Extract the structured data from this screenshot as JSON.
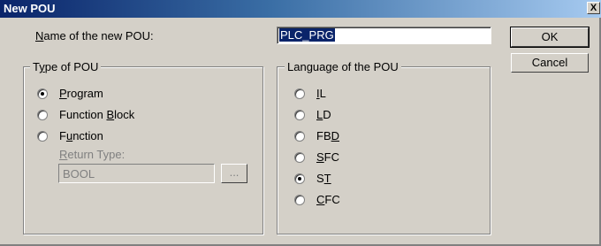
{
  "window": {
    "title": "New POU",
    "close_label": "X"
  },
  "name_label": {
    "pre": "",
    "accel": "N",
    "post": "ame of the new POU:"
  },
  "name_value": "PLC_PRG",
  "buttons": {
    "ok": "OK",
    "cancel": "Cancel"
  },
  "type_group": {
    "legend": {
      "pre": "T",
      "accel": "y",
      "post": "pe of POU"
    },
    "options": [
      {
        "pre": "",
        "accel": "P",
        "post": "rogram",
        "checked": true
      },
      {
        "pre": "Function ",
        "accel": "B",
        "post": "lock",
        "checked": false
      },
      {
        "pre": "F",
        "accel": "u",
        "post": "nction",
        "checked": false
      }
    ],
    "return_type_label": {
      "pre": "",
      "accel": "R",
      "post": "eturn Type:"
    },
    "return_type_value": "BOOL",
    "browse_label": "..."
  },
  "language_group": {
    "legend": "Language of the POU",
    "options": [
      {
        "pre": "",
        "accel": "I",
        "post": "L",
        "checked": false
      },
      {
        "pre": "",
        "accel": "L",
        "post": "D",
        "checked": false
      },
      {
        "pre": "FB",
        "accel": "D",
        "post": "",
        "checked": false
      },
      {
        "pre": "",
        "accel": "S",
        "post": "FC",
        "checked": false
      },
      {
        "pre": "S",
        "accel": "T",
        "post": "",
        "checked": true
      },
      {
        "pre": "",
        "accel": "C",
        "post": "FC",
        "checked": false
      }
    ]
  }
}
